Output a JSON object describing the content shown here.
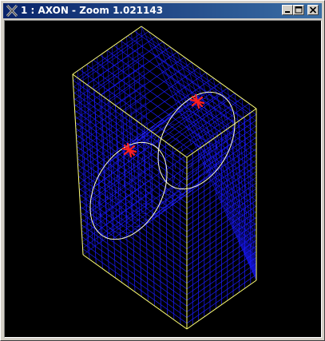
{
  "window": {
    "title": "1 : AXON - Zoom 1.021143",
    "app_icon": "x-window-icon",
    "controls": {
      "minimize": "minimize-icon",
      "maximize": "maximize-icon",
      "close": "close-icon"
    }
  },
  "viewport": {
    "background": "#000000",
    "mesh_color": "#1a1aff",
    "outline_color": "#ffff66",
    "marker_color": "#ff2020"
  }
}
